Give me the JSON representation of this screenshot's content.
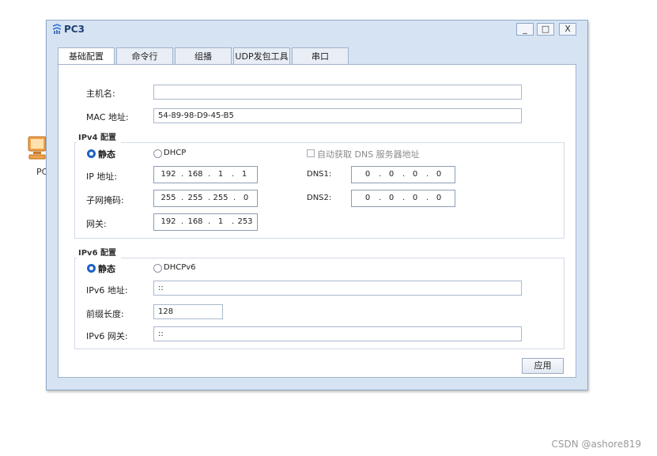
{
  "window": {
    "title": "PC3",
    "minimize_label": "_",
    "maximize_label": "□",
    "close_label": "X"
  },
  "background": {
    "pc_label": "PC"
  },
  "tabs": [
    {
      "label": "基础配置",
      "active": true
    },
    {
      "label": "命令行"
    },
    {
      "label": "组播"
    },
    {
      "label": "UDP发包工具"
    },
    {
      "label": "串口"
    }
  ],
  "basic": {
    "hostname_label": "主机名:",
    "hostname_value": "",
    "mac_label": "MAC 地址:",
    "mac_value": "54-89-98-D9-45-B5"
  },
  "ipv4": {
    "group_title": "IPv4 配置",
    "static_label": "静态",
    "dhcp_label": "DHCP",
    "auto_dns_label": "自动获取 DNS 服务器地址",
    "ip_label": "IP 地址:",
    "ip": [
      "192",
      "168",
      "1",
      "1"
    ],
    "mask_label": "子网掩码:",
    "mask": [
      "255",
      "255",
      "255",
      "0"
    ],
    "gateway_label": "网关:",
    "gateway": [
      "192",
      "168",
      "1",
      "253"
    ],
    "dns1_label": "DNS1:",
    "dns1": [
      "0",
      "0",
      "0",
      "0"
    ],
    "dns2_label": "DNS2:",
    "dns2": [
      "0",
      "0",
      "0",
      "0"
    ]
  },
  "ipv6": {
    "group_title": "IPv6 配置",
    "static_label": "静态",
    "dhcp_label": "DHCPv6",
    "addr_label": "IPv6 地址:",
    "addr_value": "::",
    "prefix_label": "前缀长度:",
    "prefix_value": "128",
    "gateway_label": "IPv6 网关:",
    "gateway_value": "::"
  },
  "apply_label": "应用",
  "watermark": "CSDN @ashore819"
}
